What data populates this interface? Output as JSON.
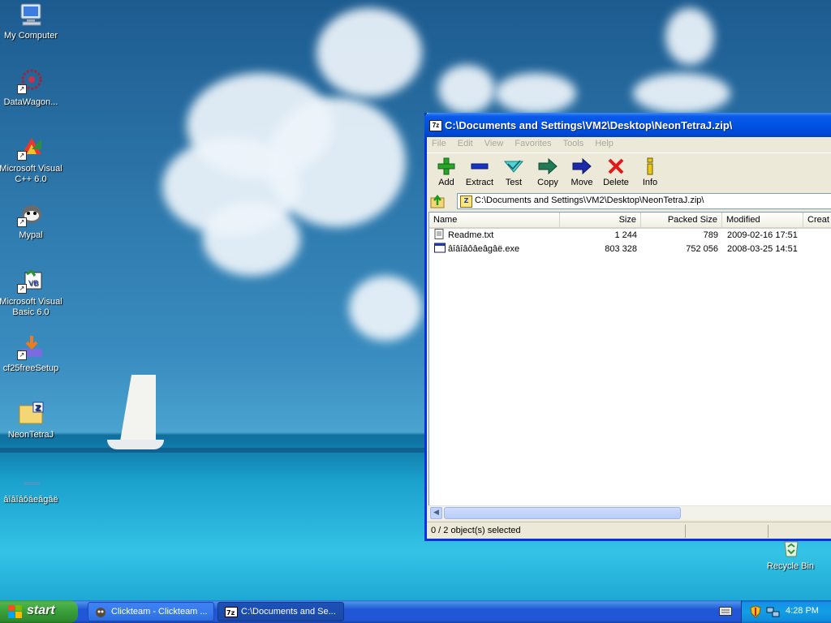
{
  "desktop": {
    "icons": [
      {
        "label": "My Computer",
        "icon": "computer-icon"
      },
      {
        "label": "DataWagon...",
        "icon": "datawagon-icon"
      },
      {
        "label": "Microsoft Visual C++ 6.0",
        "icon": "visual-cpp-icon"
      },
      {
        "label": "Mypal",
        "icon": "mypal-icon"
      },
      {
        "label": "Microsoft Visual Basic 6.0",
        "icon": "visual-basic-icon"
      },
      {
        "label": "cf25freeSetup",
        "icon": "installer-icon"
      },
      {
        "label": "NeonTetraJ",
        "icon": "zip-folder-icon"
      },
      {
        "label": "âîâîâôâeâgâë",
        "icon": "exe-icon"
      },
      {
        "label": "Recycle Bin",
        "icon": "recycle-bin-icon"
      }
    ]
  },
  "window": {
    "title": "C:\\Documents and Settings\\VM2\\Desktop\\NeonTetraJ.zip\\",
    "app_icon": "7z",
    "menu": [
      "File",
      "Edit",
      "View",
      "Favorites",
      "Tools",
      "Help"
    ],
    "toolbar": [
      {
        "label": "Add",
        "icon": "add-icon"
      },
      {
        "label": "Extract",
        "icon": "extract-icon"
      },
      {
        "label": "Test",
        "icon": "test-icon"
      },
      {
        "label": "Copy",
        "icon": "copy-icon"
      },
      {
        "label": "Move",
        "icon": "move-icon"
      },
      {
        "label": "Delete",
        "icon": "delete-icon"
      },
      {
        "label": "Info",
        "icon": "info-icon"
      }
    ],
    "address": "C:\\Documents and Settings\\VM2\\Desktop\\NeonTetraJ.zip\\",
    "columns": [
      "Name",
      "Size",
      "Packed Size",
      "Modified",
      "Creat"
    ],
    "rows": [
      {
        "name": "Readme.txt",
        "size": "1 244",
        "packed": "789",
        "modified": "2009-02-16 17:51",
        "icon": "text-file-icon"
      },
      {
        "name": "âîâîâôâeâgâë.exe",
        "size": "803 328",
        "packed": "752 056",
        "modified": "2008-03-25 14:51",
        "icon": "exe-file-icon"
      }
    ],
    "status": "0 / 2 object(s) selected"
  },
  "taskbar": {
    "start_label": "start",
    "tasks": [
      {
        "label": "Clickteam - Clickteam ...",
        "active": false
      },
      {
        "label": "C:\\Documents and Se...",
        "active": true
      }
    ],
    "clock": "4:28 PM"
  },
  "colors": {
    "xp_blue": "#0053e4",
    "start_green": "#389e38",
    "selection": "#316ac5"
  }
}
